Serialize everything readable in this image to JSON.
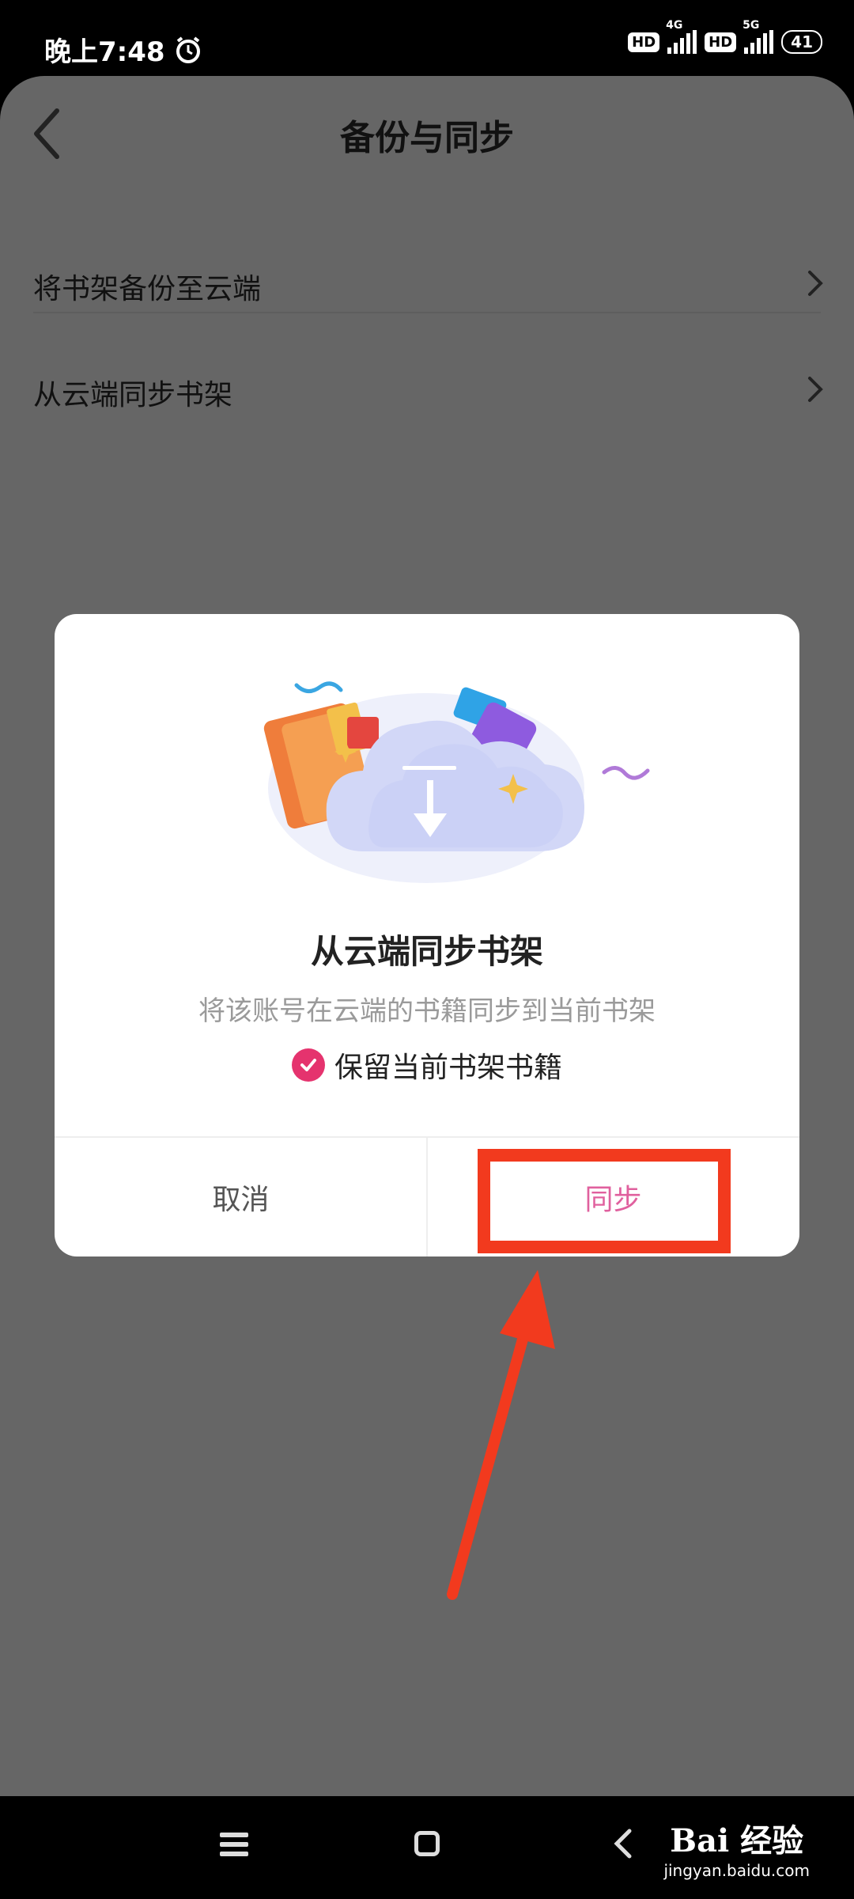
{
  "status_bar": {
    "time": "晚上7:48",
    "hd1": "HD",
    "net1": "4G",
    "hd2": "HD",
    "net2": "5G",
    "battery": "41"
  },
  "header": {
    "title": "备份与同步"
  },
  "menu": {
    "items": [
      {
        "label": "将书架备份至云端"
      },
      {
        "label": "从云端同步书架"
      }
    ]
  },
  "dialog": {
    "title": "从云端同步书架",
    "description": "将该账号在云端的书籍同步到当前书架",
    "keep_label": "保留当前书架书籍",
    "keep_checked": true,
    "cancel_label": "取消",
    "sync_label": "同步"
  },
  "colors": {
    "accent_pink": "#e0609e",
    "check_pink": "#e5336e",
    "highlight_red": "#f23a1e",
    "overlay": "#666666"
  },
  "watermark": {
    "logo": "Bai 经验",
    "url": "jingyan.baidu.com"
  }
}
